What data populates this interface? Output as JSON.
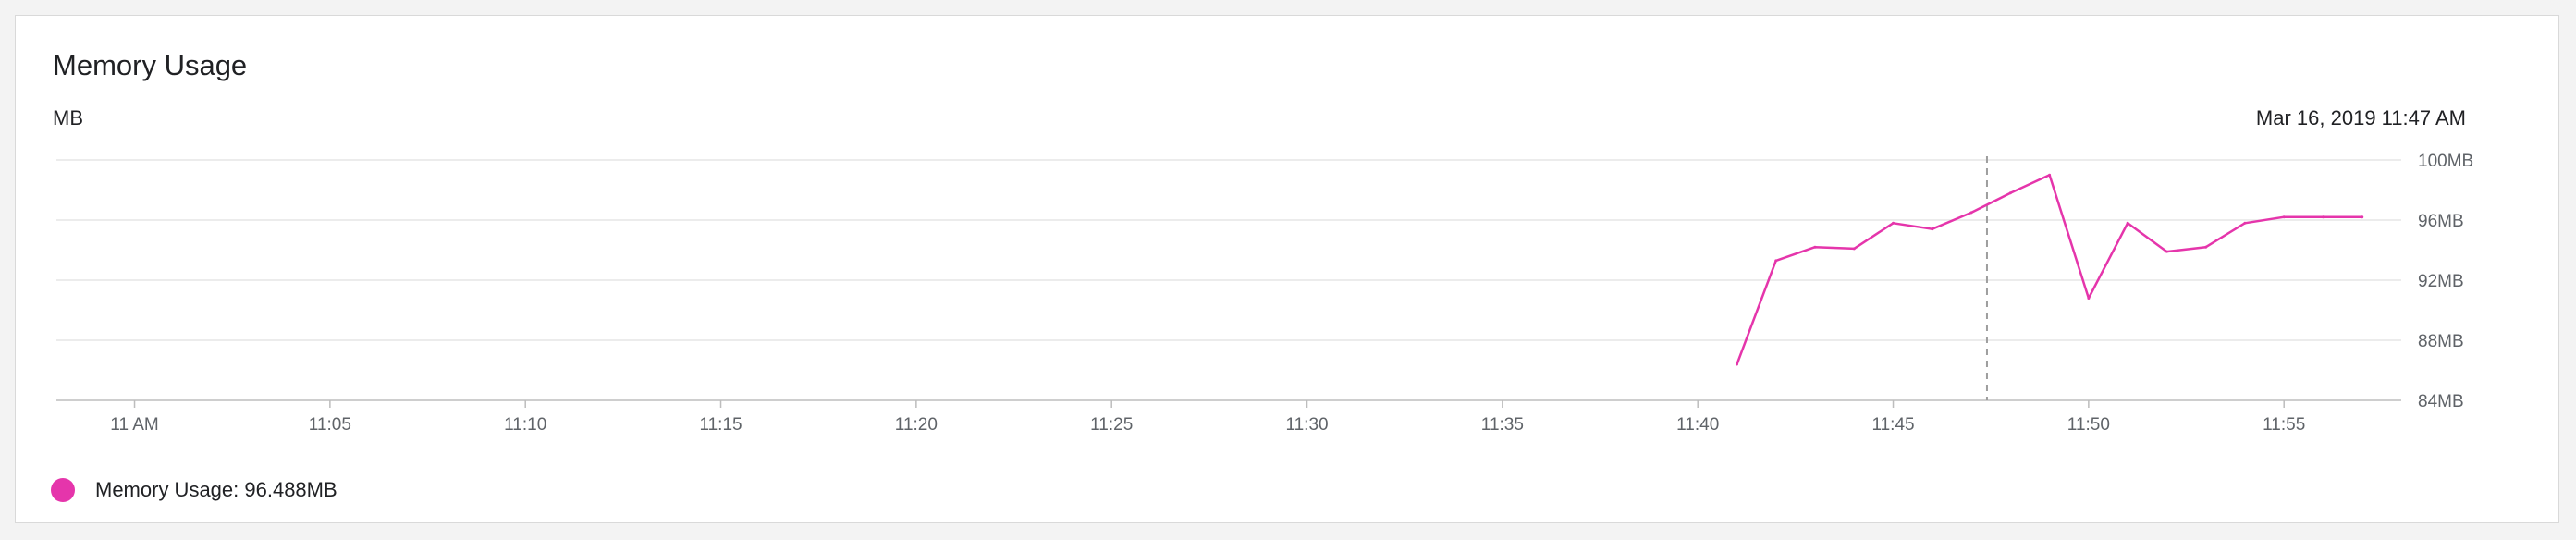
{
  "card": {
    "title": "Memory Usage",
    "unit": "MB",
    "timestamp": "Mar 16, 2019 11:47 AM"
  },
  "legend": {
    "color": "#e535ab",
    "text": "Memory Usage: 96.488MB"
  },
  "chart_data": {
    "type": "line",
    "title": "Memory Usage",
    "xlabel": "",
    "ylabel": "MB",
    "x_ticks": [
      "11 AM",
      "11:05",
      "11:10",
      "11:15",
      "11:20",
      "11:25",
      "11:30",
      "11:35",
      "11:40",
      "11:45",
      "11:50",
      "11:55"
    ],
    "y_ticks": [
      "84MB",
      "88MB",
      "92MB",
      "96MB",
      "100MB"
    ],
    "xlim": [
      "10:58",
      "11:58"
    ],
    "ylim": [
      84,
      100
    ],
    "grid": true,
    "cursor_time": "11:47",
    "series": [
      {
        "name": "Memory Usage",
        "color": "#e535ab",
        "x": [
          "11:41",
          "11:42",
          "11:43",
          "11:44",
          "11:45",
          "11:46",
          "11:47",
          "11:48",
          "11:49",
          "11:50",
          "11:51",
          "11:52",
          "11:53",
          "11:54",
          "11:55",
          "11:56",
          "11:57"
        ],
        "values": [
          86.4,
          93.3,
          94.2,
          94.1,
          95.8,
          95.4,
          96.5,
          97.8,
          99.0,
          90.8,
          95.8,
          93.9,
          94.2,
          95.8,
          96.2,
          96.2,
          96.2
        ]
      }
    ]
  }
}
